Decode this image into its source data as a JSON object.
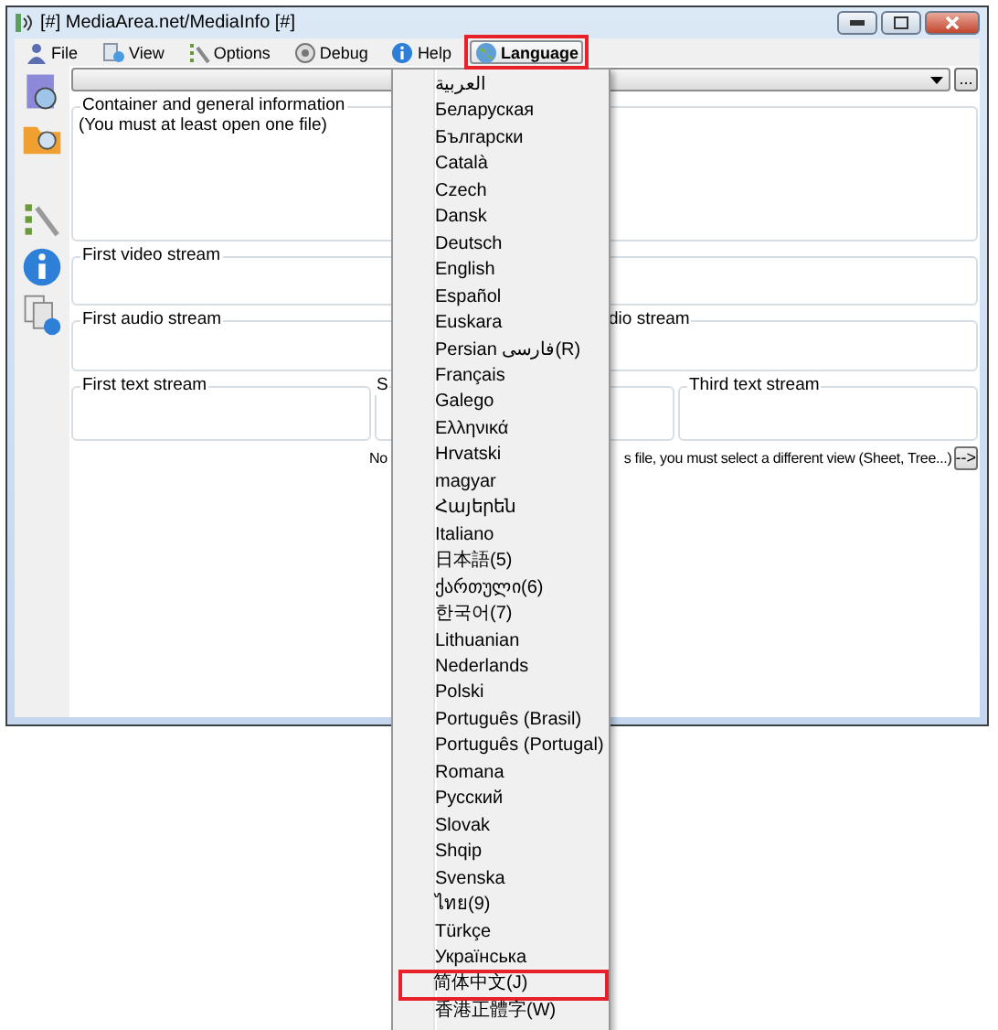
{
  "window": {
    "title": "[#] MediaArea.net/MediaInfo [#]"
  },
  "menu_bar": [
    {
      "label": "File",
      "selected": false,
      "annotated": false
    },
    {
      "label": "View",
      "selected": false,
      "annotated": false
    },
    {
      "label": "Options",
      "selected": false,
      "annotated": false
    },
    {
      "label": "Debug",
      "selected": false,
      "annotated": false
    },
    {
      "label": "Help",
      "selected": false,
      "annotated": false
    },
    {
      "label": "Language",
      "selected": true,
      "annotated": true
    }
  ],
  "view_selector": {
    "button": "..."
  },
  "group_rows": [
    [
      {
        "label": "Container and general information",
        "text": "(You must at least open one file)"
      }
    ],
    [
      {
        "label": "First video stream"
      }
    ],
    [
      {
        "label": "First audio stream"
      },
      {
        "label": "dio stream"
      }
    ],
    [
      {
        "label": "First text stream"
      },
      {
        "label": "S"
      },
      {
        "label": "Third text stream"
      }
    ]
  ],
  "notice": {
    "text_before": "No",
    "text_after": "s file, you must select a different view (Sheet, Tree...)",
    "button": "-->"
  },
  "language_menu": {
    "items": [
      {
        "label": "العربية",
        "annotated": false
      },
      {
        "label": "Беларуская",
        "annotated": false
      },
      {
        "label": "Български",
        "annotated": false
      },
      {
        "label": "Català",
        "annotated": false
      },
      {
        "label": "Czech",
        "annotated": false
      },
      {
        "label": "Dansk",
        "annotated": false
      },
      {
        "label": "Deutsch",
        "annotated": false
      },
      {
        "label": "English",
        "annotated": false
      },
      {
        "label": "Español",
        "annotated": false
      },
      {
        "label": "Euskara",
        "annotated": false
      },
      {
        "label": "Persian  فارسی(R)",
        "annotated": false
      },
      {
        "label": "Français",
        "annotated": false
      },
      {
        "label": "Galego",
        "annotated": false
      },
      {
        "label": "Ελληνικά",
        "annotated": false
      },
      {
        "label": "Hrvatski",
        "annotated": false
      },
      {
        "label": "magyar",
        "annotated": false
      },
      {
        "label": "Հայերեն",
        "annotated": false
      },
      {
        "label": "Italiano",
        "annotated": false
      },
      {
        "label": "日本語(5)",
        "annotated": false
      },
      {
        "label": "ქართული(6)",
        "annotated": false
      },
      {
        "label": "한국어(7)",
        "annotated": false
      },
      {
        "label": "Lithuanian",
        "annotated": false
      },
      {
        "label": "Nederlands",
        "annotated": false
      },
      {
        "label": "Polski",
        "annotated": false
      },
      {
        "label": "Português (Brasil)",
        "annotated": false
      },
      {
        "label": "Português (Portugal)",
        "annotated": false
      },
      {
        "label": "Romana",
        "annotated": false
      },
      {
        "label": "Русский",
        "annotated": false
      },
      {
        "label": "Slovak",
        "annotated": false
      },
      {
        "label": "Shqip",
        "annotated": false
      },
      {
        "label": "Svenska",
        "annotated": false
      },
      {
        "label": "ไทย(9)",
        "annotated": false
      },
      {
        "label": "Türkçe",
        "annotated": false
      },
      {
        "label": "Українська",
        "annotated": false
      },
      {
        "label": "简体中文(J)",
        "annotated": true
      },
      {
        "label": "香港正體字(W)",
        "annotated": false
      }
    ]
  }
}
